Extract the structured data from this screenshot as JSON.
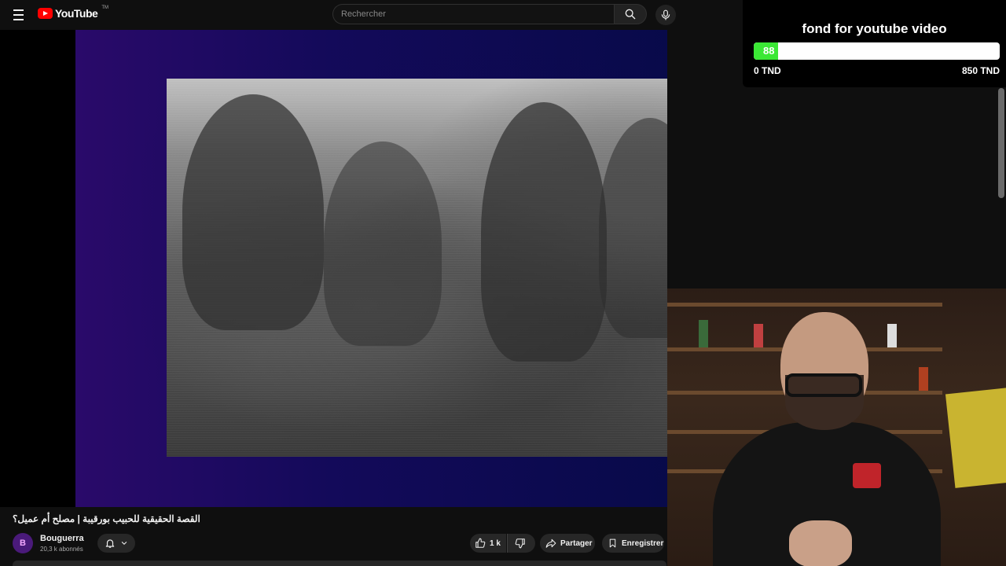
{
  "header": {
    "logo_text": "YouTube",
    "logo_tm": "TM",
    "search_placeholder": "Rechercher",
    "icons": {
      "menu": "menu-icon",
      "search": "search-icon",
      "mic": "microphone-icon"
    }
  },
  "overlay": {
    "title": "fond for youtube video",
    "progress_value": "88",
    "progress_fraction": 0.1,
    "min_label": "0 TND",
    "max_label": "850 TND",
    "fill_color": "#3be835"
  },
  "video_info": {
    "title": "القصة الحقيقية للحبيب بورقيبة | مصلح أم عميل؟",
    "channel": "Bouguerra",
    "avatar_letter": "B",
    "subscribers": "20,3 k abonnés",
    "like_count": "1 k",
    "share_label": "Partager",
    "save_label": "Enregistrer",
    "icons": {
      "bell": "bell-icon",
      "chevron": "chevron-down-icon",
      "like": "thumbs-up-icon",
      "dislike": "thumbs-down-icon",
      "share": "share-icon",
      "save": "bookmark-icon"
    }
  },
  "colors": {
    "brand": "#ff0000",
    "background": "#0f0f0f",
    "pill": "#272727"
  }
}
